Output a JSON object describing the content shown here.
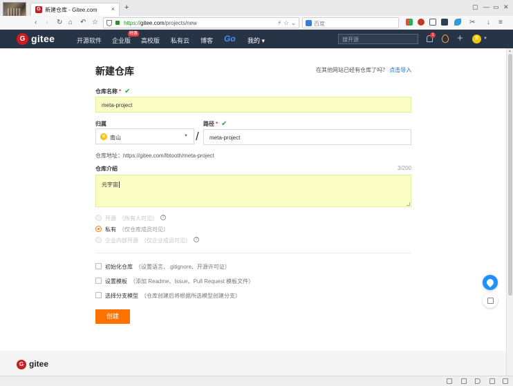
{
  "browser": {
    "tab": {
      "title": "新建仓库 - Gitee.com",
      "favicon": "gitee-favicon",
      "close": "×"
    },
    "new_tab": "+",
    "url_scheme": "https://",
    "url_host": "gitee.com",
    "url_path": "/projects/new",
    "search_engine_placeholder": "百度",
    "window_buttons": [
      "▢",
      "—",
      "▭",
      "✕"
    ]
  },
  "header": {
    "brand": "gitee",
    "logo_letter": "G",
    "nav": [
      "开源软件",
      "企业版",
      "高校版",
      "私有云",
      "博客"
    ],
    "enterprise_badge": "特惠",
    "go": "Go",
    "mine": "我的 ▾",
    "search_placeholder": "搜开源",
    "notify_count": "1",
    "plus": "+",
    "avatar_text": "南"
  },
  "page": {
    "title": "新建仓库",
    "import_hint": "在其他网站已经有仓库了吗？",
    "import_link": "点击导入",
    "repo_name_label": "仓库名称",
    "repo_name_value": "meta-project",
    "owner_label": "归属",
    "owner_value": "南山",
    "owner_avatar": "南",
    "path_label": "路径",
    "path_value": "meta-project",
    "slash": "/",
    "required_mark": "*",
    "check_mark": "✔",
    "repo_address_label": "仓库地址：",
    "repo_address_value": "https://gitee.com/lbtooth/meta-project",
    "intro_label": "仓库介绍",
    "intro_counter": "3/200",
    "intro_value": "元宇宙",
    "visibility": [
      {
        "label": "开源",
        "sub": "（所有人可见）",
        "help": "?",
        "selected": false,
        "disabled": true
      },
      {
        "label": "私有",
        "sub": "（仅仓库成员可见）",
        "help": "",
        "selected": true,
        "disabled": false
      },
      {
        "label": "企业内部开源",
        "sub": "（仅企业成员可见）",
        "help": "?",
        "selected": false,
        "disabled": true
      }
    ],
    "options": [
      {
        "label": "初始化仓库",
        "sub": "（设置语言、.gitignore、开源许可证）"
      },
      {
        "label": "设置模板",
        "sub": "（添加 Readme、Issue、Pull Request 模板文件）"
      },
      {
        "label": "选择分支模型",
        "sub": "（仓库创建后将根据所选模型创建分支）"
      }
    ],
    "create_button": "创建"
  },
  "footer": {
    "brand": "gitee",
    "logo_letter": "G"
  },
  "colors": {
    "header_bg": "#263445",
    "accent": "#fe7300",
    "link": "#096dd9",
    "valid": "#28a745",
    "input_filled_bg": "#fafec5"
  }
}
